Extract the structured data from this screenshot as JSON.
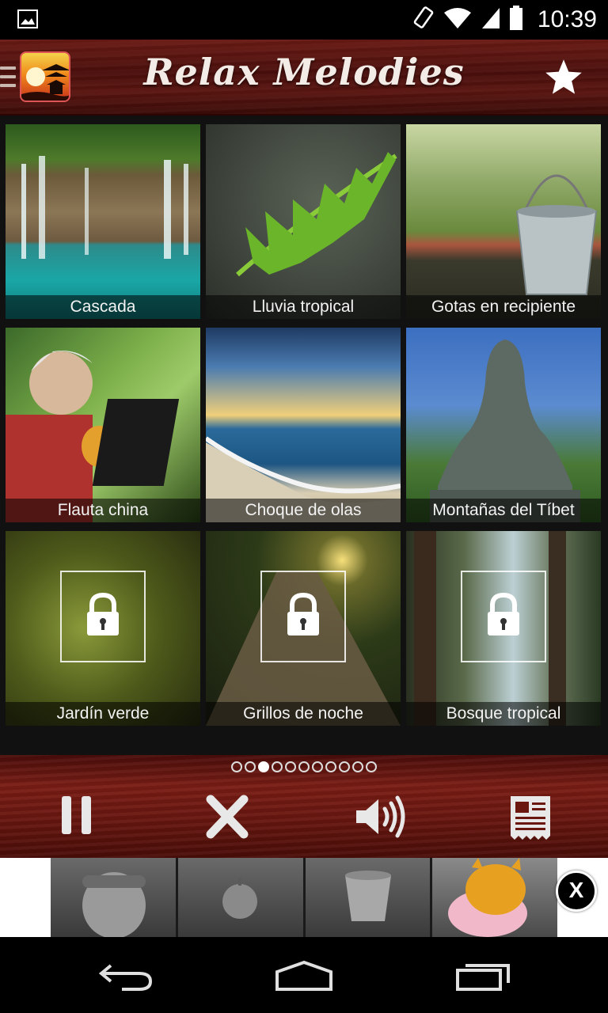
{
  "status_bar": {
    "time": "10:39"
  },
  "header": {
    "title": "Relax Melodies"
  },
  "tiles": [
    {
      "label": "Cascada",
      "locked": false
    },
    {
      "label": "Lluvia tropical",
      "locked": false
    },
    {
      "label": "Gotas en recipiente",
      "locked": false
    },
    {
      "label": "Flauta china",
      "locked": false
    },
    {
      "label": "Choque de olas",
      "locked": false
    },
    {
      "label": "Montañas del Tíbet",
      "locked": false
    },
    {
      "label": "Jardín verde",
      "locked": true
    },
    {
      "label": "Grillos de noche",
      "locked": true
    },
    {
      "label": "Bosque tropical",
      "locked": true
    }
  ],
  "pager": {
    "total": 11,
    "current": 3
  },
  "ad": {
    "close_label": "X"
  },
  "colors": {
    "wood_red": "#6a1710",
    "caption_bg": "#000000",
    "accent": "#ffffff"
  }
}
